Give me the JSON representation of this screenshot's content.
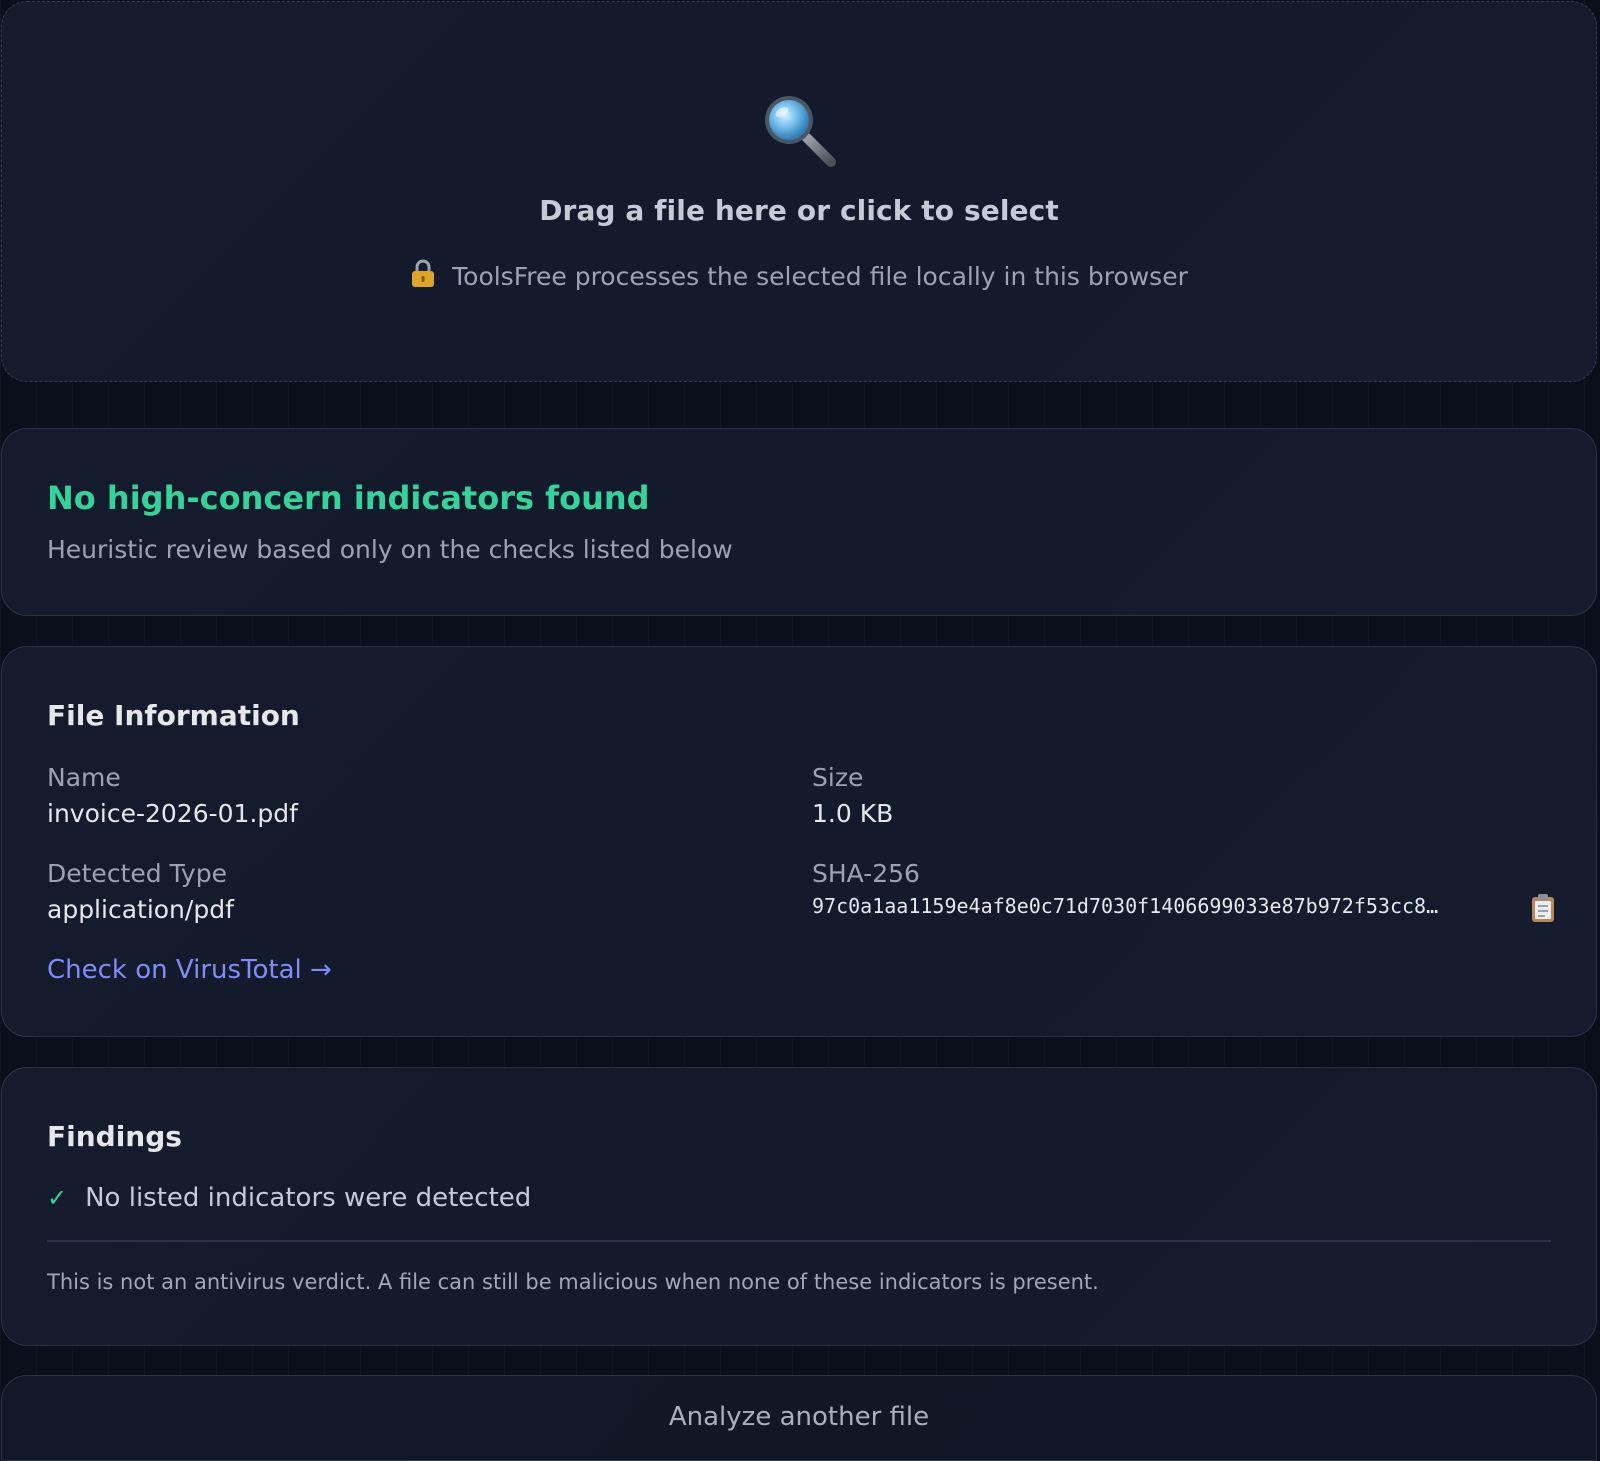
{
  "dropzone": {
    "icon": "magnifier-icon",
    "title": "Drag a file here or click to select",
    "lock_icon": "lock-icon",
    "privacy_note": "ToolsFree processes the selected file locally in this browser"
  },
  "summary": {
    "title": "No high-concern indicators found",
    "subtitle": "Heuristic review based only on the checks listed below",
    "status_color": "#34d399"
  },
  "file_info": {
    "heading": "File Information",
    "name_label": "Name",
    "name_value": "invoice-2026-01.pdf",
    "size_label": "Size",
    "size_value": "1.0 KB",
    "type_label": "Detected Type",
    "type_value": "application/pdf",
    "hash_label": "SHA-256",
    "hash_value": "97c0a1aa1159e4af8e0c71d7030f1406699033e87b972f53cc8…",
    "copy_icon": "clipboard-icon",
    "virustotal_link": "Check on VirusTotal →",
    "link_color": "#818cf8"
  },
  "findings": {
    "heading": "Findings",
    "items": [
      {
        "icon": "check-icon",
        "text": "No listed indicators were detected"
      }
    ],
    "disclaimer": "This is not an antivirus verdict. A file can still be malicious when none of these indicators is present."
  },
  "actions": {
    "analyze_another": "Analyze another file"
  }
}
